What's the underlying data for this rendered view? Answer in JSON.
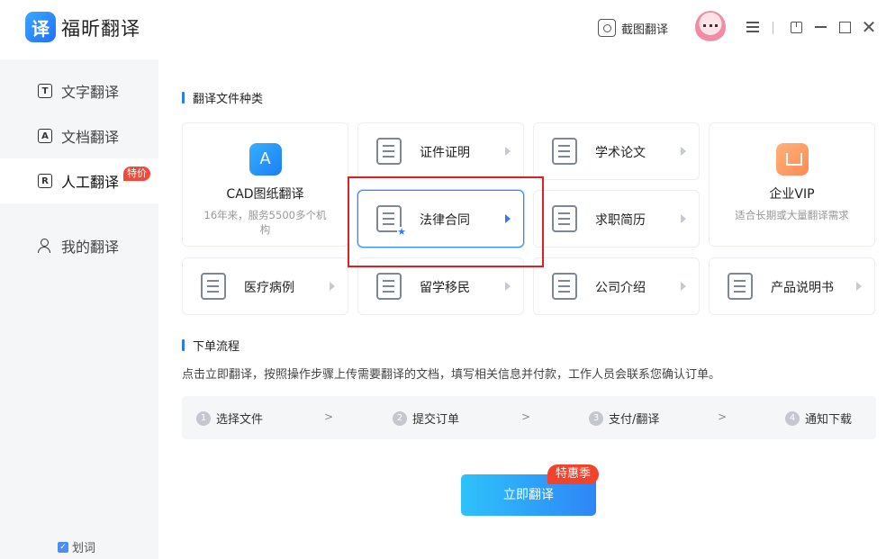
{
  "app": {
    "logo_char": "译",
    "name": "福昕翻译"
  },
  "titlebar": {
    "screenshot_label": "截图翻译"
  },
  "sidebar": {
    "items": [
      {
        "label": "文字翻译",
        "icon": "T"
      },
      {
        "label": "文档翻译",
        "icon": "A"
      },
      {
        "label": "人工翻译",
        "icon": "R",
        "badge": "特价"
      },
      {
        "label": "我的翻译"
      }
    ],
    "huaci_label": "划词"
  },
  "main": {
    "section1_title": "翻译文件种类",
    "cards": {
      "cad": {
        "title": "CAD图纸翻译",
        "desc": "16年来，服务5500多个机构",
        "icon": "A"
      },
      "certificate": "证件证明",
      "thesis": "学术论文",
      "vip": {
        "title": "企业VIP",
        "desc": "适合长期或大量翻译需求"
      },
      "legal": "法律合同",
      "resume": "求职简历",
      "medical": "医疗病例",
      "immigration": "留学移民",
      "company": "公司介绍",
      "manual": "产品说明书"
    },
    "section2_title": "下单流程",
    "flow_desc": "点击立即翻译，按照操作步骤上传需要翻译的文档，填写相关信息并付款，工作人员会联系您确认订单。",
    "steps": [
      {
        "num": "1",
        "label": "选择文件"
      },
      {
        "num": "2",
        "label": "提交订单"
      },
      {
        "num": "3",
        "label": "支付/翻译"
      },
      {
        "num": "4",
        "label": "通知下载"
      }
    ],
    "step_separator": ">",
    "cta_label": "立即翻译",
    "cta_badge": "特惠季"
  },
  "colors": {
    "accent": "#2f7bf6",
    "badge_red": "#f04b3a",
    "highlight": "#e02020"
  }
}
